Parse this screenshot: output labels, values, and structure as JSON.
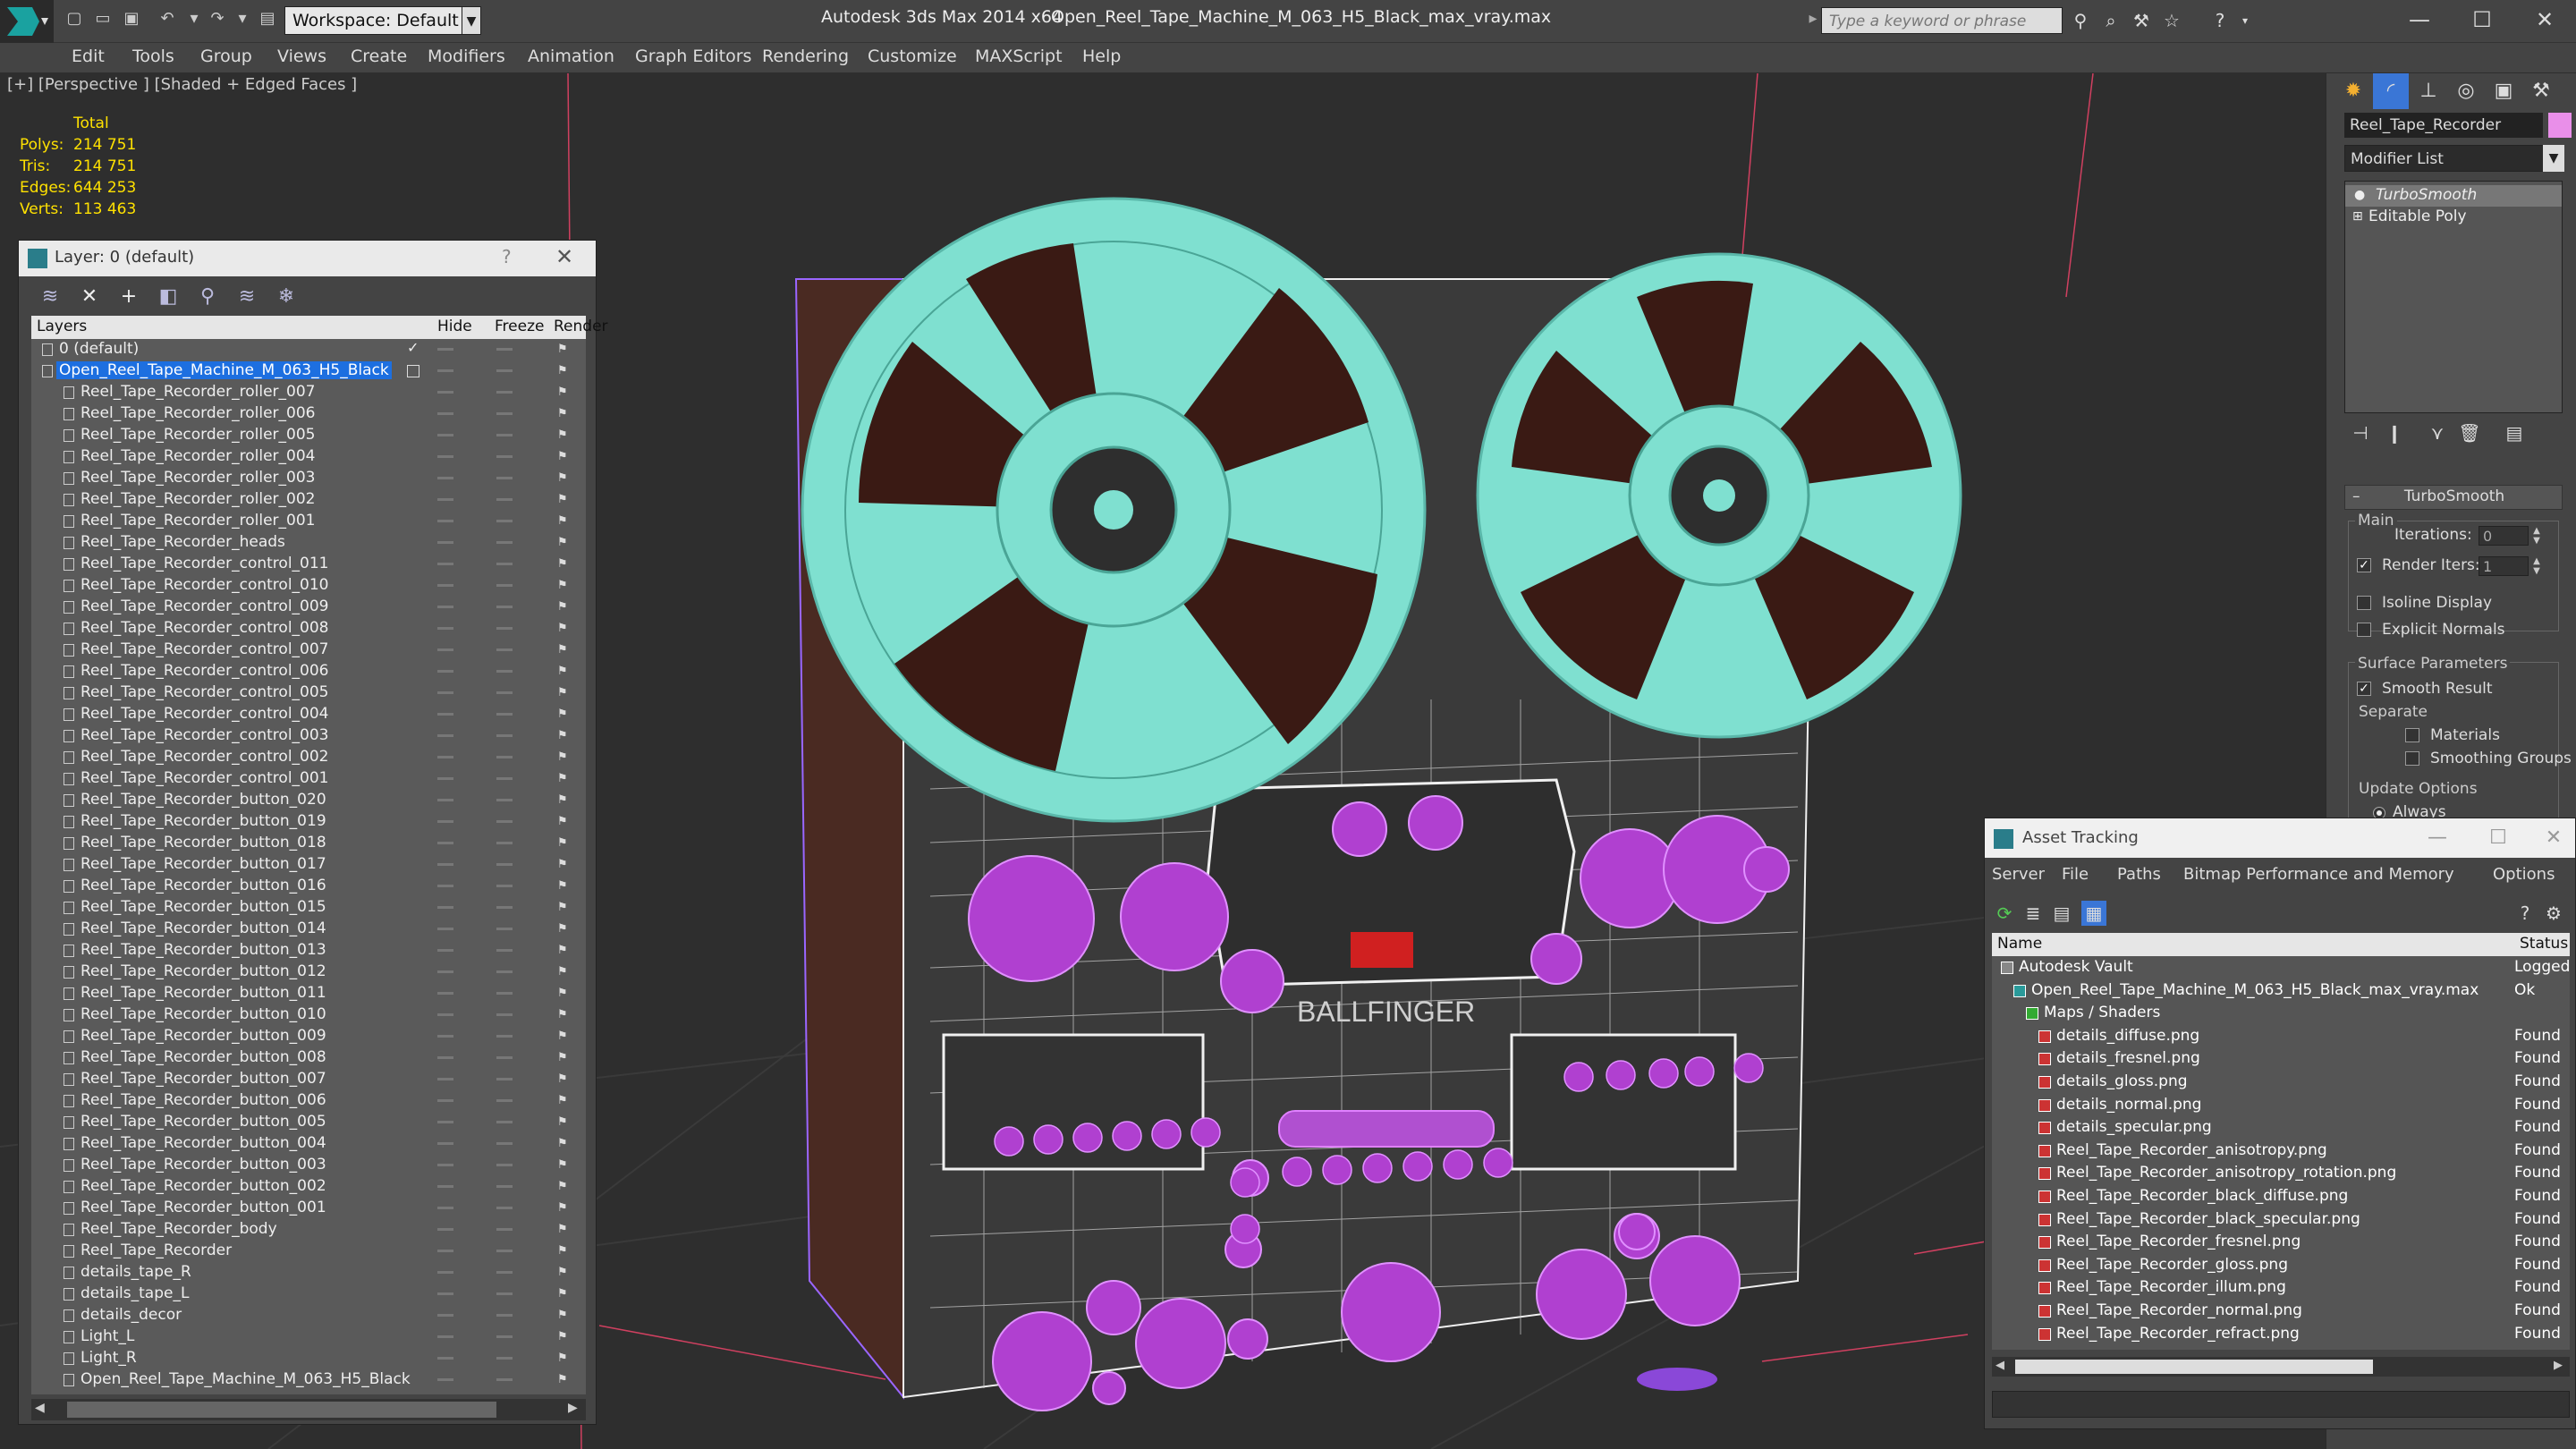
{
  "titlebar": {
    "workspace": "Workspace: Default",
    "app_title": "Autodesk 3ds Max  2014 x64",
    "file_title": "Open_Reel_Tape_Machine_M_063_H5_Black_max_vray.max",
    "search_placeholder": "Type a keyword or phrase",
    "minimize": "—",
    "maximize": "☐",
    "close": "✕"
  },
  "menubar": [
    "Edit",
    "Tools",
    "Group",
    "Views",
    "Create",
    "Modifiers",
    "Animation",
    "Graph Editors",
    "Rendering",
    "Customize",
    "MAXScript",
    "Help"
  ],
  "viewport": {
    "label": "[+] [Perspective ] [Shaded + Edged Faces ]",
    "stats": {
      "total_label": "Total",
      "rows": [
        {
          "label": "Polys:",
          "value": "214 751"
        },
        {
          "label": "Tris:",
          "value": "214 751"
        },
        {
          "label": "Edges:",
          "value": "644 253"
        },
        {
          "label": "Verts:",
          "value": "113 463"
        }
      ]
    },
    "model_text": "BALLFINGER"
  },
  "layer_panel": {
    "title": "Layer: 0 (default)",
    "help": "?",
    "close": "✕",
    "headers": {
      "layers": "Layers",
      "hide": "Hide",
      "freeze": "Freeze",
      "render": "Render"
    },
    "rows": [
      "0 (default)",
      "Open_Reel_Tape_Machine_M_063_H5_Black",
      "Reel_Tape_Recorder_roller_007",
      "Reel_Tape_Recorder_roller_006",
      "Reel_Tape_Recorder_roller_005",
      "Reel_Tape_Recorder_roller_004",
      "Reel_Tape_Recorder_roller_003",
      "Reel_Tape_Recorder_roller_002",
      "Reel_Tape_Recorder_roller_001",
      "Reel_Tape_Recorder_heads",
      "Reel_Tape_Recorder_control_011",
      "Reel_Tape_Recorder_control_010",
      "Reel_Tape_Recorder_control_009",
      "Reel_Tape_Recorder_control_008",
      "Reel_Tape_Recorder_control_007",
      "Reel_Tape_Recorder_control_006",
      "Reel_Tape_Recorder_control_005",
      "Reel_Tape_Recorder_control_004",
      "Reel_Tape_Recorder_control_003",
      "Reel_Tape_Recorder_control_002",
      "Reel_Tape_Recorder_control_001",
      "Reel_Tape_Recorder_button_020",
      "Reel_Tape_Recorder_button_019",
      "Reel_Tape_Recorder_button_018",
      "Reel_Tape_Recorder_button_017",
      "Reel_Tape_Recorder_button_016",
      "Reel_Tape_Recorder_button_015",
      "Reel_Tape_Recorder_button_014",
      "Reel_Tape_Recorder_button_013",
      "Reel_Tape_Recorder_button_012",
      "Reel_Tape_Recorder_button_011",
      "Reel_Tape_Recorder_button_010",
      "Reel_Tape_Recorder_button_009",
      "Reel_Tape_Recorder_button_008",
      "Reel_Tape_Recorder_button_007",
      "Reel_Tape_Recorder_button_006",
      "Reel_Tape_Recorder_button_005",
      "Reel_Tape_Recorder_button_004",
      "Reel_Tape_Recorder_button_003",
      "Reel_Tape_Recorder_button_002",
      "Reel_Tape_Recorder_button_001",
      "Reel_Tape_Recorder_body",
      "Reel_Tape_Recorder",
      "details_tape_R",
      "details_tape_L",
      "details_decor",
      "Light_L",
      "Light_R",
      "Open_Reel_Tape_Machine_M_063_H5_Black"
    ],
    "selected_index": 1
  },
  "command_panel": {
    "object_name": "Reel_Tape_Recorder",
    "object_color": "#e98fe9",
    "modifier_list": "Modifier List",
    "stack": [
      "TurboSmooth",
      "Editable Poly"
    ],
    "turbosmooth": {
      "title": "TurboSmooth",
      "main": "Main",
      "iterations_label": "Iterations:",
      "iterations_value": "0",
      "render_iters_label": "Render Iters:",
      "render_iters_value": "1",
      "isoline": "Isoline Display",
      "explicit_normals": "Explicit Normals",
      "surface_params": "Surface Parameters",
      "smooth_result": "Smooth Result",
      "separate": "Separate",
      "materials": "Materials",
      "smoothing_groups": "Smoothing Groups",
      "update_options": "Update Options",
      "always": "Always"
    }
  },
  "asset_tracking": {
    "title": "Asset Tracking",
    "menu": [
      "Server",
      "File",
      "Paths",
      "Bitmap Performance and Memory",
      "Options"
    ],
    "headers": {
      "name": "Name",
      "status": "Status"
    },
    "rows": [
      {
        "name": "Autodesk Vault",
        "status": "Logged Out",
        "level": 0,
        "kind": "vault"
      },
      {
        "name": "Open_Reel_Tape_Machine_M_063_H5_Black_max_vray.max",
        "status": "Ok",
        "level": 1,
        "kind": "max"
      },
      {
        "name": "Maps / Shaders",
        "status": "",
        "level": 2,
        "kind": "maps"
      },
      {
        "name": "details_diffuse.png",
        "status": "Found",
        "level": 3,
        "kind": "png"
      },
      {
        "name": "details_fresnel.png",
        "status": "Found",
        "level": 3,
        "kind": "png"
      },
      {
        "name": "details_gloss.png",
        "status": "Found",
        "level": 3,
        "kind": "png"
      },
      {
        "name": "details_normal.png",
        "status": "Found",
        "level": 3,
        "kind": "png"
      },
      {
        "name": "details_specular.png",
        "status": "Found",
        "level": 3,
        "kind": "png"
      },
      {
        "name": "Reel_Tape_Recorder_anisotropy.png",
        "status": "Found",
        "level": 3,
        "kind": "png"
      },
      {
        "name": "Reel_Tape_Recorder_anisotropy_rotation.png",
        "status": "Found",
        "level": 3,
        "kind": "png"
      },
      {
        "name": "Reel_Tape_Recorder_black_diffuse.png",
        "status": "Found",
        "level": 3,
        "kind": "png"
      },
      {
        "name": "Reel_Tape_Recorder_black_specular.png",
        "status": "Found",
        "level": 3,
        "kind": "png"
      },
      {
        "name": "Reel_Tape_Recorder_fresnel.png",
        "status": "Found",
        "level": 3,
        "kind": "png"
      },
      {
        "name": "Reel_Tape_Recorder_gloss.png",
        "status": "Found",
        "level": 3,
        "kind": "png"
      },
      {
        "name": "Reel_Tape_Recorder_illum.png",
        "status": "Found",
        "level": 3,
        "kind": "png"
      },
      {
        "name": "Reel_Tape_Recorder_normal.png",
        "status": "Found",
        "level": 3,
        "kind": "png"
      },
      {
        "name": "Reel_Tape_Recorder_refract.png",
        "status": "Found",
        "level": 3,
        "kind": "png"
      }
    ]
  },
  "colors": {
    "stats_yellow": "#ffe100",
    "selection_blue": "#1d6fe0",
    "wire_cyan": "#7fe0d0",
    "wire_magenta": "#c040e0",
    "wire_white": "#f0f0f0"
  }
}
